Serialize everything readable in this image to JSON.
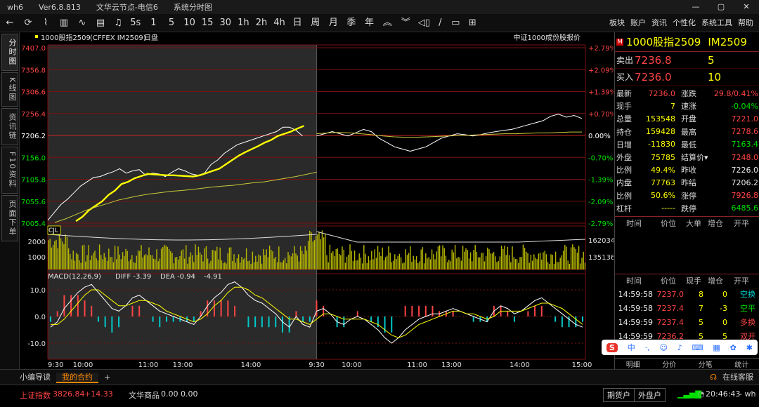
{
  "app": {
    "title": "wh6",
    "version": "Ver6.8.813",
    "server": "文华云节点-电信6",
    "window_name": "系统分时图"
  },
  "window_controls": {
    "minimize": "—",
    "maximize": "▢",
    "close": "✕"
  },
  "toolbar": {
    "periods": [
      "5s",
      "1",
      "5",
      "10",
      "15",
      "30",
      "1h",
      "2h",
      "4h",
      "日",
      "周",
      "月",
      "季",
      "年"
    ],
    "right_menu": [
      "板块",
      "账户",
      "资讯",
      "个性化",
      "系统工具",
      "帮助"
    ]
  },
  "left_nav": [
    {
      "label": "分时图",
      "active": true
    },
    {
      "label": "K线图",
      "active": false
    },
    {
      "label": "资讯链",
      "active": false
    },
    {
      "label": "F10资料",
      "active": false
    },
    {
      "label": "页面下单",
      "active": false
    }
  ],
  "chart_header": {
    "name": "1000股指2509",
    "suffix": "(CFFEX IM2509)",
    "period": "日盘",
    "right": "中证1000成份股报价"
  },
  "volume_label": "CJL",
  "macd_legend": {
    "name": "MACD(12,26,9)",
    "diff": "DIFF -3.39",
    "dea": "DEA -0.94",
    "macd": "-4.91"
  },
  "vol_right_labels": [
    "162034",
    "135136"
  ],
  "time_axis": [
    "9:30",
    "10:00",
    "11:00",
    "13:00",
    "14:00",
    "9:30",
    "10:00",
    "11:00",
    "13:00",
    "14:00",
    "15:00"
  ],
  "chart_data": {
    "type": "line",
    "price_ticks": [
      "7407.0",
      "7356.8",
      "7306.6",
      "7256.4",
      "7206.2",
      "7156.0",
      "7105.8",
      "7055.6",
      "7005.4"
    ],
    "pct_ticks": [
      "+2.79%",
      "+2.09%",
      "+1.39%",
      "+0.70%",
      "0.00%",
      "-0.70%",
      "-1.39%",
      "-2.09%",
      "-2.79%"
    ],
    "price_range": [
      7005.4,
      7407.0
    ],
    "prev_settle": 7206.2,
    "volume_ticks": [
      "2000",
      "1000"
    ],
    "macd_ticks": [
      "10.0",
      "0.0",
      "-10.0"
    ],
    "series": [
      {
        "color": "#ffffff",
        "values": [
          7012,
          7030,
          7048,
          7060,
          7075,
          7090,
          7100,
          7110,
          7112,
          7118,
          7123,
          7130,
          7120,
          7125,
          7128,
          7115,
          7120,
          7118,
          7112,
          7122,
          7130,
          7125,
          7118,
          7115,
          7120,
          7140,
          7150,
          7165,
          7175,
          7185,
          7190,
          7195,
          7200,
          7205,
          7210,
          7215,
          7225,
          7225,
          7218,
          7205
        ]
      },
      {
        "color": "#ffff00",
        "values": [
          7010,
          7020,
          7035,
          7045,
          7055,
          7070,
          7080,
          7095,
          7100,
          7108,
          7113,
          7118,
          7117,
          7116,
          7115,
          7115,
          7114,
          7113,
          7112,
          7115,
          7120,
          7125,
          7130,
          7140,
          7150,
          7160,
          7168,
          7175,
          7182,
          7190,
          7196,
          7205,
          7210,
          7215,
          7222,
          7228
        ]
      },
      {
        "color": "#c9c93a",
        "values": [
          7007,
          7015,
          7025,
          7035,
          7043,
          7050,
          7058,
          7063,
          7068,
          7072,
          7075,
          7078,
          7080,
          7082,
          7085,
          7088,
          7090,
          7092,
          7095,
          7098,
          7100,
          7104,
          7108,
          7112,
          7117,
          7122
        ]
      },
      {
        "color": "#ffffff",
        "values": [
          7205,
          7210,
          7215,
          7210,
          7205,
          7212,
          7220,
          7215,
          7200,
          7190,
          7180,
          7175,
          7170,
          7175,
          7180,
          7190,
          7200,
          7205,
          7210,
          7208,
          7205,
          7208,
          7212,
          7215,
          7218,
          7220,
          7225,
          7230,
          7235,
          7240,
          7250,
          7255,
          7248,
          7252,
          7245
        ]
      },
      {
        "color": "#c9c93a",
        "values": [
          7210,
          7212,
          7213,
          7212,
          7210,
          7208,
          7205,
          7203,
          7202,
          7202,
          7203,
          7204,
          7205,
          7206,
          7207,
          7208,
          7209,
          7210,
          7210,
          7211,
          7212,
          7212,
          7213,
          7214,
          7214
        ]
      }
    ],
    "macd": {
      "diff": [
        -4,
        -2,
        3,
        6,
        9,
        11,
        12,
        9,
        6,
        3,
        2,
        4,
        7,
        8,
        6,
        4,
        2,
        1,
        0,
        -1,
        -2,
        -3,
        0,
        4,
        7,
        9,
        12,
        13,
        11,
        8,
        6,
        5,
        3,
        1,
        -2,
        -4,
        0,
        -3,
        -4,
        2,
        3,
        1,
        -2,
        -3,
        -1,
        0,
        -1,
        -3,
        -5,
        -8,
        -10,
        -8,
        -5,
        -3,
        -1,
        0,
        1,
        1,
        2,
        3,
        2,
        1,
        0,
        -1,
        -2,
        2,
        4,
        3,
        1,
        2,
        4,
        6,
        7,
        5,
        3,
        1,
        -1,
        -3,
        -4
      ],
      "dea": [
        -3,
        -3,
        -1,
        2,
        5,
        8,
        10,
        10,
        8,
        6,
        4,
        4,
        5,
        6,
        6,
        5,
        4,
        2,
        1,
        0,
        -1,
        -2,
        -1,
        1,
        4,
        6,
        9,
        11,
        11,
        10,
        8,
        7,
        5,
        3,
        1,
        -1,
        -1,
        -2,
        -3,
        -1,
        1,
        1,
        0,
        -1,
        -1,
        -1,
        -1,
        -2,
        -3,
        -5,
        -7,
        -8,
        -7,
        -5,
        -3,
        -2,
        -1,
        0,
        1,
        2,
        2,
        1,
        1,
        0,
        -1,
        0,
        2,
        2,
        2,
        2,
        3,
        4,
        5,
        5,
        4,
        3,
        1,
        -1,
        -3
      ]
    }
  },
  "quote": {
    "symbol": "1000股指2509",
    "code": "IM2509",
    "sell_label": "卖出",
    "sell_price": "7236.8",
    "sell_vol": "5",
    "buy_label": "买入",
    "buy_price": "7236.0",
    "buy_vol": "10",
    "rows": [
      {
        "l1": "最新",
        "v1": "7236.0",
        "c1": "red",
        "l2": "涨跌",
        "v2": "29.8/0.41%",
        "c2": "red"
      },
      {
        "l1": "现手",
        "v1": "7",
        "c1": "yel",
        "l2": "速涨",
        "v2": "-0.04%",
        "c2": "grn"
      },
      {
        "l1": "总量",
        "v1": "153548",
        "c1": "yel",
        "l2": "开盘",
        "v2": "7221.0",
        "c2": "red"
      },
      {
        "l1": "持仓",
        "v1": "159428",
        "c1": "yel",
        "l2": "最高",
        "v2": "7278.6",
        "c2": "red"
      },
      {
        "l1": "日增",
        "v1": "-11830",
        "c1": "yel",
        "l2": "最低",
        "v2": "7163.4",
        "c2": "grn"
      },
      {
        "l1": "外盘",
        "v1": "75785",
        "c1": "yel",
        "l2": "结算价▾",
        "v2": "7248.0",
        "c2": "red"
      },
      {
        "l1": "比例",
        "v1": "49.4%",
        "c1": "yel",
        "l2": "昨收",
        "v2": "7226.0",
        "c2": "wht"
      },
      {
        "l1": "内盘",
        "v1": "77763",
        "c1": "yel",
        "l2": "昨结",
        "v2": "7206.2",
        "c2": "wht"
      },
      {
        "l1": "比例",
        "v1": "50.6%",
        "c1": "yel",
        "l2": "涨停",
        "v2": "7926.8",
        "c2": "red"
      },
      {
        "l1": "杠杆",
        "v1": "-----",
        "c1": "yel",
        "l2": "跌停",
        "v2": "6485.6",
        "c2": "grn"
      }
    ]
  },
  "tick_header": [
    "时间",
    "价位",
    "大单",
    "增仓",
    "开平"
  ],
  "trade_header": [
    "时间",
    "价位",
    "现手",
    "增仓",
    "开平"
  ],
  "trades": [
    {
      "time": "14:59:58",
      "price": "7237.0",
      "vol": "8",
      "inc": "0",
      "type": "空换",
      "tc": "cyn"
    },
    {
      "time": "14:59:58",
      "price": "7237.4",
      "vol": "7",
      "inc": "-3",
      "type": "空平",
      "tc": "grn"
    },
    {
      "time": "14:59:59",
      "price": "7237.4",
      "vol": "5",
      "inc": "0",
      "type": "多换",
      "tc": "red"
    },
    {
      "time": "14:59:59",
      "price": "7236.2",
      "vol": "5",
      "inc": "5",
      "type": "双开",
      "tc": "red"
    }
  ],
  "right_tabs": [
    "明细",
    "分价",
    "分笔",
    "统计"
  ],
  "ime_label": "中",
  "bottom_tabs": [
    {
      "label": "小编导读",
      "active": false
    },
    {
      "label": "我的合约",
      "active": true
    }
  ],
  "add_tab": "+",
  "online_service": "在线客服",
  "status": {
    "index_name": "上证指数",
    "index_value": "3826.84",
    "index_change": "+14.33",
    "goods_name": "文华商品",
    "goods_value": "0.00",
    "goods_change": "0.00",
    "btn1": "期货户",
    "btn2": "外盘户",
    "time": "20:46:43",
    "user": "- wh"
  },
  "colors": {
    "up": "#ff4444",
    "down": "#00e000",
    "accent": "#ffff00",
    "grid": "#7a1010"
  }
}
